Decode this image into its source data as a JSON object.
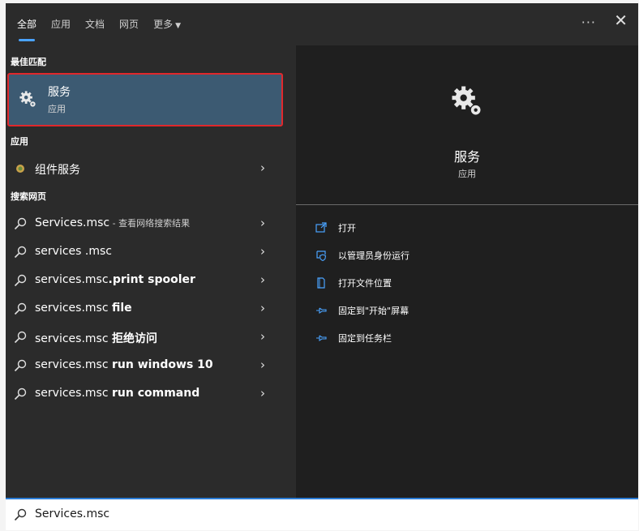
{
  "tabs": [
    {
      "label": "全部",
      "active": true
    },
    {
      "label": "应用"
    },
    {
      "label": "文档"
    },
    {
      "label": "网页"
    },
    {
      "label": "更多"
    }
  ],
  "more_dots": "···",
  "close_glyph": "✕",
  "sections": {
    "best_match": "最佳匹配",
    "apps": "应用",
    "web": "搜索网页"
  },
  "best_match": {
    "name": "服务",
    "type": "应用",
    "icon": "gear-icon"
  },
  "apps": [
    {
      "label": "组件服务",
      "icon": "component-services-icon"
    }
  ],
  "web_results": [
    {
      "prefix": "Services.msc",
      "bold": "",
      "hint": " - 查看网络搜索结果"
    },
    {
      "prefix": "services .msc",
      "bold": "",
      "hint": ""
    },
    {
      "prefix": "services.msc",
      "bold": ".print spooler",
      "hint": ""
    },
    {
      "prefix": "services.msc ",
      "bold": "file",
      "hint": ""
    },
    {
      "prefix": "services.msc ",
      "bold": "拒绝访问",
      "hint": ""
    },
    {
      "prefix": "services.msc ",
      "bold": "run windows 10",
      "hint": ""
    },
    {
      "prefix": "services.msc ",
      "bold": "run command",
      "hint": ""
    }
  ],
  "details": {
    "name": "服务",
    "type": "应用",
    "actions": [
      {
        "label": "打开",
        "icon": "open-icon"
      },
      {
        "label": "以管理员身份运行",
        "icon": "shield-icon"
      },
      {
        "label": "打开文件位置",
        "icon": "file-location-icon"
      },
      {
        "label": "固定到\"开始\"屏幕",
        "icon": "pin-icon"
      },
      {
        "label": "固定到任务栏",
        "icon": "pin-icon"
      }
    ]
  },
  "search": {
    "value": "Services.msc"
  },
  "colors": {
    "accent": "#4aa3ff",
    "highlight": "#3c5a72",
    "outline": "#e0282c"
  }
}
